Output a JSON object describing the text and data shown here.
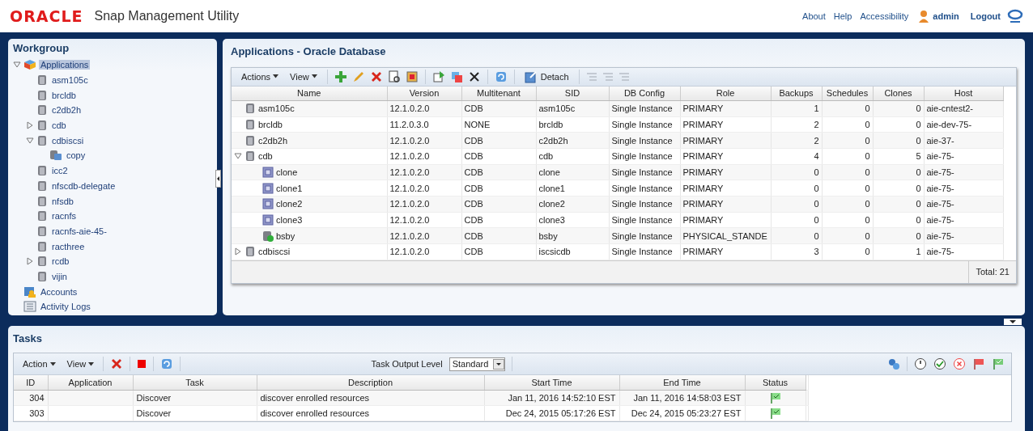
{
  "header": {
    "logo": "ORACLE",
    "product": "Snap Management Utility",
    "links": [
      "About",
      "Help",
      "Accessibility"
    ],
    "user": "admin",
    "logout": "Logout"
  },
  "workgroup": {
    "title": "Workgroup",
    "items": [
      {
        "label": "Applications",
        "kind": "apps",
        "selected": true,
        "expanded": true,
        "children": [
          {
            "label": "asm105c",
            "kind": "db",
            "selected": false
          },
          {
            "label": "brcldb",
            "kind": "db",
            "selected": false
          },
          {
            "label": "c2db2h",
            "kind": "db",
            "selected": false
          },
          {
            "label": "cdb",
            "kind": "db",
            "selected": false,
            "expanded": false
          },
          {
            "label": "cdbiscsi",
            "kind": "db",
            "selected": false,
            "expanded": true,
            "children": [
              {
                "label": "copy",
                "kind": "copy",
                "selected": false
              }
            ]
          },
          {
            "label": "icc2",
            "kind": "db",
            "selected": false
          },
          {
            "label": "nfscdb-delegate",
            "kind": "db",
            "selected": false
          },
          {
            "label": "nfsdb",
            "kind": "db",
            "selected": false
          },
          {
            "label": "racnfs",
            "kind": "db",
            "selected": false
          },
          {
            "label": "racnfs-aie-45-",
            "kind": "db",
            "selected": false
          },
          {
            "label": "racthree",
            "kind": "db",
            "selected": false
          },
          {
            "label": "rcdb",
            "kind": "db",
            "selected": false,
            "expanded": false
          },
          {
            "label": "vijin",
            "kind": "db",
            "selected": false
          }
        ]
      },
      {
        "label": "Accounts",
        "kind": "accounts",
        "selected": false
      },
      {
        "label": "Activity Logs",
        "kind": "logs",
        "selected": false
      }
    ]
  },
  "applications": {
    "title": "Applications - Oracle Database",
    "menus": [
      "Actions",
      "View"
    ],
    "detach": "Detach",
    "columns": [
      "Name",
      "Version",
      "Multitenant",
      "SID",
      "DB Config",
      "Role",
      "Backups",
      "Schedules",
      "Clones",
      "Host"
    ],
    "rows": [
      {
        "kind": "db",
        "cells": [
          "asm105c",
          "12.1.0.2.0",
          "CDB",
          "asm105c",
          "Single Instance",
          "PRIMARY",
          "1",
          "0",
          "0",
          "aie-cntest2-"
        ]
      },
      {
        "kind": "db",
        "cells": [
          "brcldb",
          "11.2.0.3.0",
          "NONE",
          "brcldb",
          "Single Instance",
          "PRIMARY",
          "2",
          "0",
          "0",
          "aie-dev-75-"
        ]
      },
      {
        "kind": "db",
        "cells": [
          "c2db2h",
          "12.1.0.2.0",
          "CDB",
          "c2db2h",
          "Single Instance",
          "PRIMARY",
          "2",
          "0",
          "0",
          "aie-37-"
        ]
      },
      {
        "kind": "db",
        "expanded": true,
        "cells": [
          "cdb",
          "12.1.0.2.0",
          "CDB",
          "cdb",
          "Single Instance",
          "PRIMARY",
          "4",
          "0",
          "5",
          "aie-75-"
        ],
        "children": [
          {
            "kind": "clone",
            "cells": [
              "clone",
              "12.1.0.2.0",
              "CDB",
              "clone",
              "Single Instance",
              "PRIMARY",
              "0",
              "0",
              "0",
              "aie-75-"
            ]
          },
          {
            "kind": "clone",
            "cells": [
              "clone1",
              "12.1.0.2.0",
              "CDB",
              "clone1",
              "Single Instance",
              "PRIMARY",
              "0",
              "0",
              "0",
              "aie-75-"
            ]
          },
          {
            "kind": "clone",
            "cells": [
              "clone2",
              "12.1.0.2.0",
              "CDB",
              "clone2",
              "Single Instance",
              "PRIMARY",
              "0",
              "0",
              "0",
              "aie-75-"
            ]
          },
          {
            "kind": "clone",
            "cells": [
              "clone3",
              "12.1.0.2.0",
              "CDB",
              "clone3",
              "Single Instance",
              "PRIMARY",
              "0",
              "0",
              "0",
              "aie-75-"
            ]
          },
          {
            "kind": "standby",
            "cells": [
              "bsby",
              "12.1.0.2.0",
              "CDB",
              "bsby",
              "Single Instance",
              "PHYSICAL_STANDE",
              "0",
              "0",
              "0",
              "aie-75-"
            ]
          }
        ]
      },
      {
        "kind": "db",
        "expanded": false,
        "cells": [
          "cdbiscsi",
          "12.1.0.2.0",
          "CDB",
          "iscsicdb",
          "Single Instance",
          "PRIMARY",
          "3",
          "0",
          "1",
          "aie-75-"
        ]
      }
    ],
    "total": "Total: 21"
  },
  "tasks": {
    "title": "Tasks",
    "menus": [
      "Action",
      "View"
    ],
    "output_label": "Task Output Level",
    "output_value": "Standard",
    "columns": [
      "ID",
      "Application",
      "Task",
      "Description",
      "Start Time",
      "End Time",
      "Status"
    ],
    "rows": [
      {
        "cells": [
          "304",
          "",
          "Discover",
          "discover enrolled resources",
          "Jan 11, 2016 14:52:10 EST",
          "Jan 11, 2016 14:58:03 EST"
        ],
        "kind": "success"
      },
      {
        "cells": [
          "303",
          "",
          "Discover",
          "discover enrolled resources",
          "Dec 24, 2015 05:17:26 EST",
          "Dec 24, 2015 05:23:27 EST"
        ],
        "kind": "success"
      }
    ]
  }
}
